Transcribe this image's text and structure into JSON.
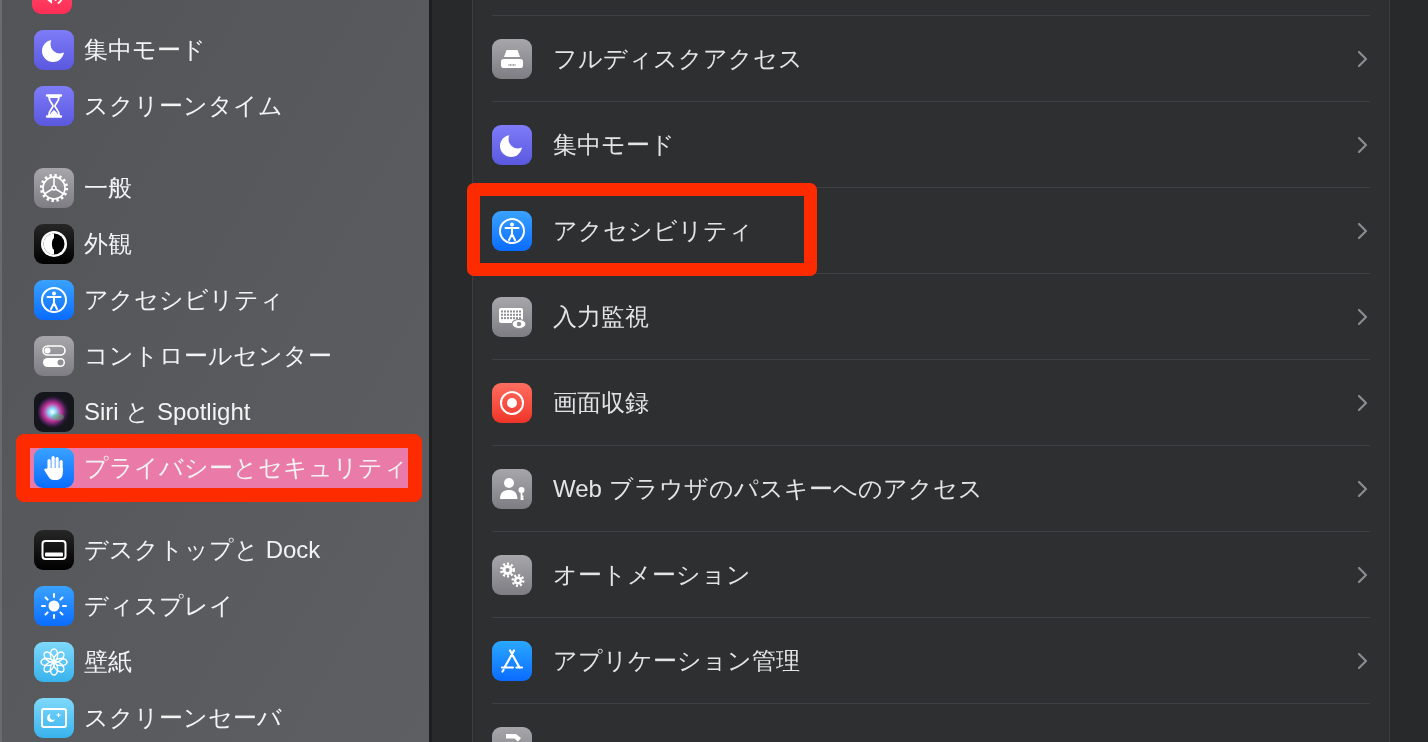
{
  "sidebar": {
    "groups": [
      {
        "items": [
          {
            "label": "集中モード",
            "selected": false,
            "highlighted": false
          },
          {
            "label": "スクリーンタイム",
            "selected": false,
            "highlighted": false
          }
        ]
      },
      {
        "items": [
          {
            "label": "一般",
            "selected": false,
            "highlighted": false
          },
          {
            "label": "外観",
            "selected": false,
            "highlighted": false
          },
          {
            "label": "アクセシビリティ",
            "selected": false,
            "highlighted": false
          },
          {
            "label": "コントロールセンター",
            "selected": false,
            "highlighted": false
          },
          {
            "label": "Siri と Spotlight",
            "selected": false,
            "highlighted": false
          },
          {
            "label": "プライバシーとセキュリティ",
            "selected": true,
            "highlighted": true
          }
        ]
      },
      {
        "items": [
          {
            "label": "デスクトップと Dock",
            "selected": false,
            "highlighted": false
          },
          {
            "label": "ディスプレイ",
            "selected": false,
            "highlighted": false
          },
          {
            "label": "壁紙",
            "selected": false,
            "highlighted": false
          },
          {
            "label": "スクリーンセーバ",
            "selected": false,
            "highlighted": false
          }
        ]
      }
    ]
  },
  "privacy_list": {
    "rows": [
      {
        "label": "フルディスクアクセス",
        "highlighted": false
      },
      {
        "label": "集中モード",
        "highlighted": false
      },
      {
        "label": "アクセシビリティ",
        "highlighted": true
      },
      {
        "label": "入力監視",
        "highlighted": false
      },
      {
        "label": "画面収録",
        "highlighted": false
      },
      {
        "label": "Web ブラウザのパスキーへのアクセス",
        "highlighted": false
      },
      {
        "label": "オートメーション",
        "highlighted": false
      },
      {
        "label": "アプリケーション管理",
        "highlighted": false
      }
    ]
  }
}
